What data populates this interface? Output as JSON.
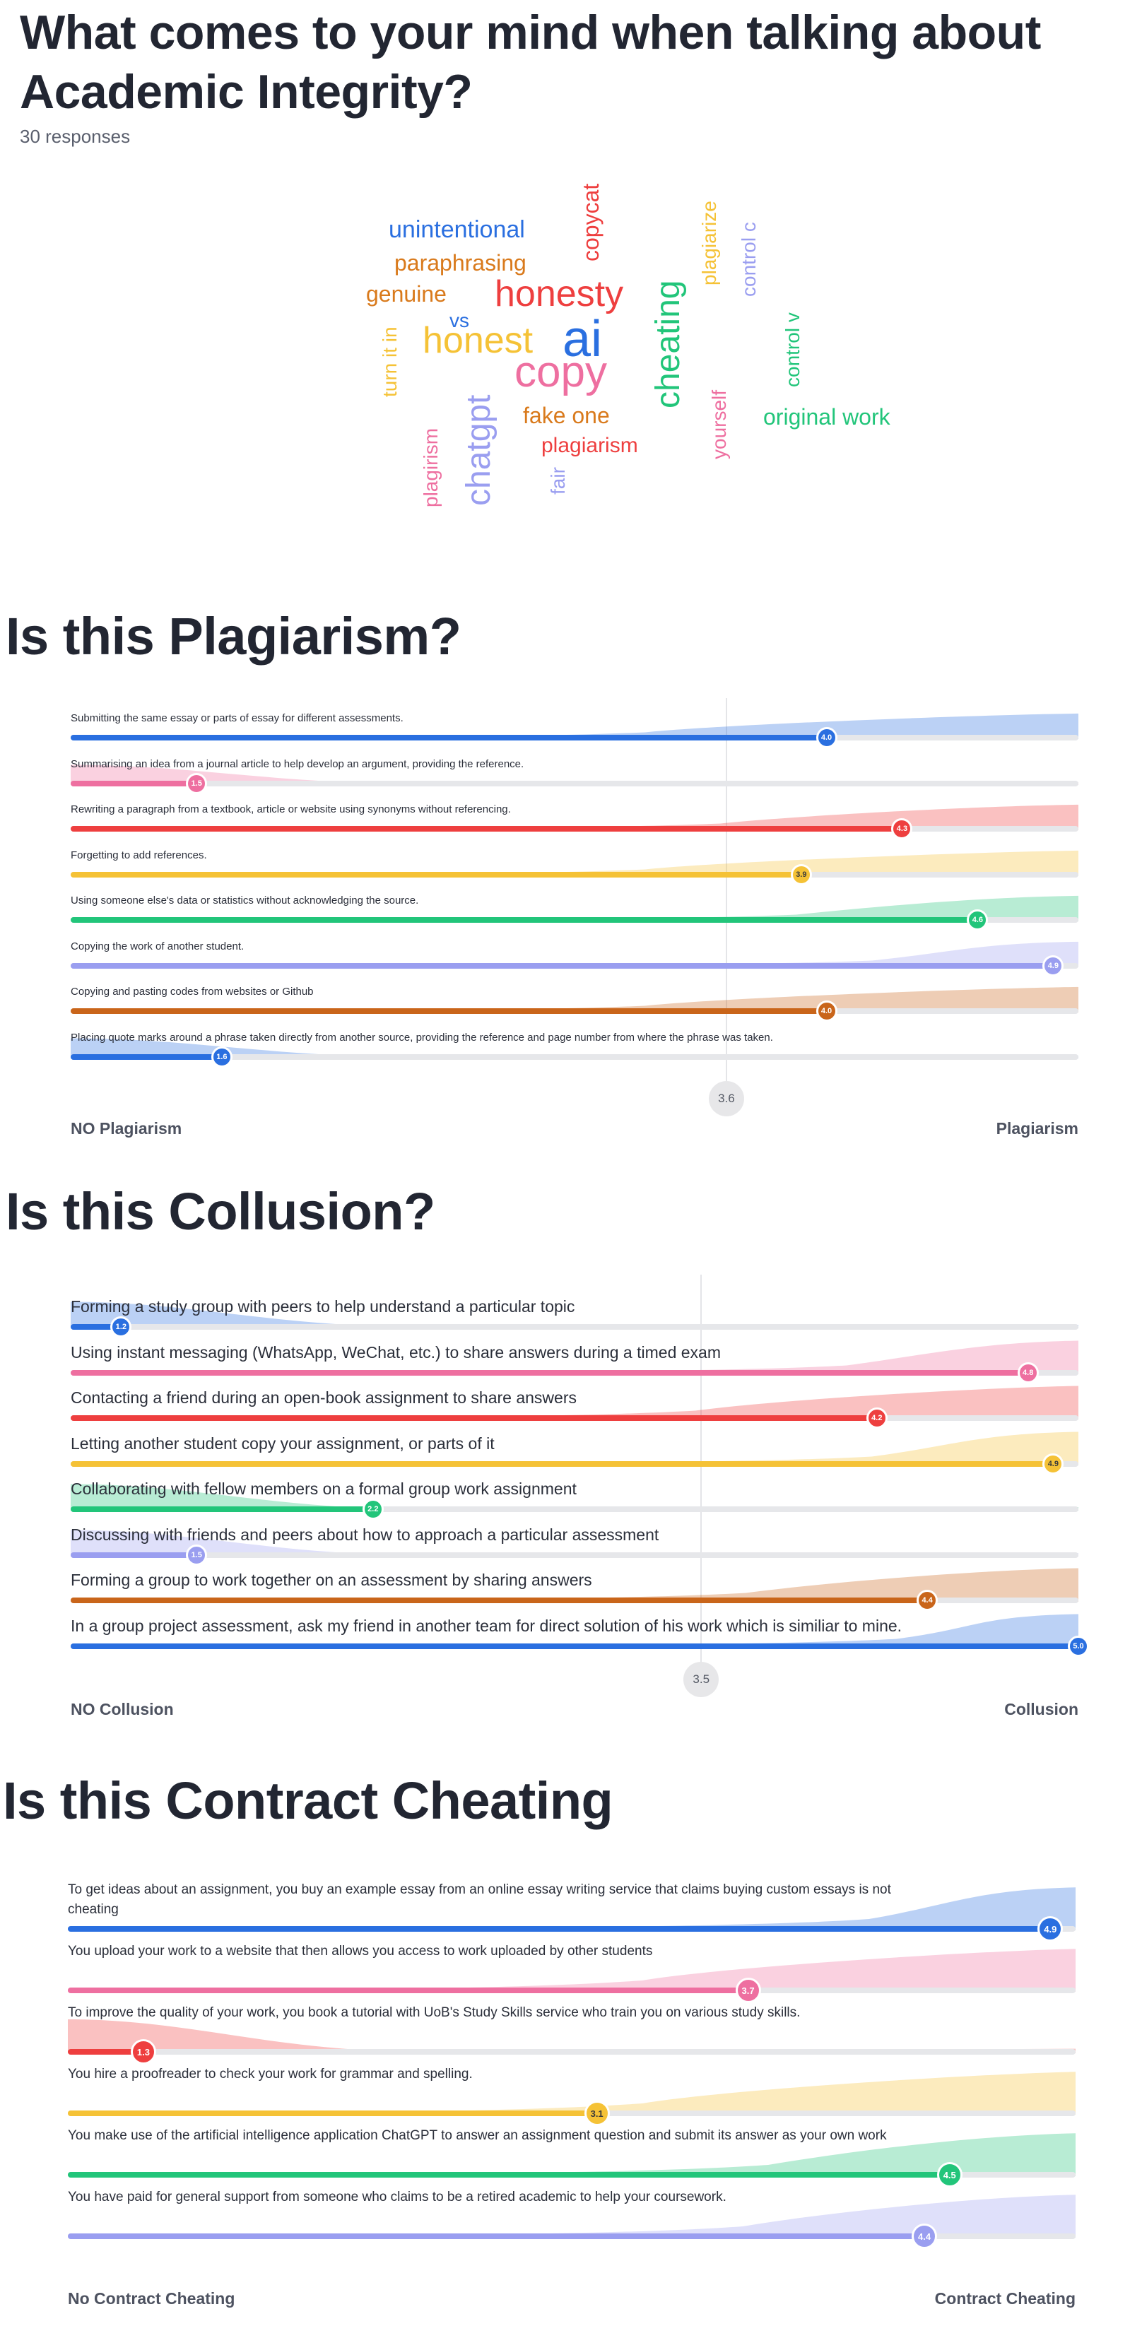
{
  "wordcloud": {
    "title_line1": "What comes to your mind when talking about",
    "title_line2": "Academic Integrity?",
    "responses": "30 responses",
    "words": [
      {
        "text": "unintentional",
        "color": "#2a6fe0",
        "size": 34,
        "vertical": false
      },
      {
        "text": "paraphrasing",
        "color": "#d97a1c",
        "size": 32,
        "vertical": false
      },
      {
        "text": "genuine",
        "color": "#d97a1c",
        "size": 32,
        "vertical": false
      },
      {
        "text": "honesty",
        "color": "#ee3f3f",
        "size": 52,
        "vertical": false
      },
      {
        "text": "vs",
        "color": "#2a6fe0",
        "size": 28,
        "vertical": false
      },
      {
        "text": "honest",
        "color": "#f5c236",
        "size": 52,
        "vertical": false
      },
      {
        "text": "ai",
        "color": "#2a6fe0",
        "size": 72,
        "vertical": false
      },
      {
        "text": "copy",
        "color": "#ee6fa0",
        "size": 62,
        "vertical": false
      },
      {
        "text": "fake one",
        "color": "#d97a1c",
        "size": 32,
        "vertical": false
      },
      {
        "text": "plagiarism",
        "color": "#ee3f3f",
        "size": 30,
        "vertical": false
      },
      {
        "text": "original work",
        "color": "#22c57a",
        "size": 32,
        "vertical": false
      },
      {
        "text": "copycat",
        "color": "#ee3f3f",
        "size": 32,
        "vertical": true
      },
      {
        "text": "plagiarize",
        "color": "#f5c236",
        "size": 28,
        "vertical": true
      },
      {
        "text": "control c",
        "color": "#9a9ef0",
        "size": 28,
        "vertical": true
      },
      {
        "text": "cheating",
        "color": "#22c57a",
        "size": 48,
        "vertical": true
      },
      {
        "text": "control v",
        "color": "#22c57a",
        "size": 28,
        "vertical": true
      },
      {
        "text": "turn it in",
        "color": "#f5c236",
        "size": 28,
        "vertical": true
      },
      {
        "text": "chatgpt",
        "color": "#9a9ef0",
        "size": 48,
        "vertical": true
      },
      {
        "text": "plagirism",
        "color": "#ee6fa0",
        "size": 28,
        "vertical": true
      },
      {
        "text": "yourself",
        "color": "#ee6fa0",
        "size": 28,
        "vertical": true
      },
      {
        "text": "fair",
        "color": "#9a9ef0",
        "size": 28,
        "vertical": true
      }
    ]
  },
  "plagiarism": {
    "title": "Is this Plagiarism?",
    "left_label": "NO Plagiarism",
    "right_label": "Plagiarism",
    "average": "3.6",
    "items": [
      {
        "text": "Submitting the same essay or parts of essay for different assessments.",
        "value": 4.0,
        "label": "4.0",
        "color": "#2a6fe0"
      },
      {
        "text": "Summarising an idea from a journal article to help develop an argument, providing the reference.",
        "value": 1.5,
        "label": "1.5",
        "color": "#ee6fa0"
      },
      {
        "text": "Rewriting a paragraph from a textbook, article or website using synonyms without referencing.",
        "value": 4.3,
        "label": "4.3",
        "color": "#ee3f3f"
      },
      {
        "text": "Forgetting to add references.",
        "value": 3.9,
        "label": "3.9",
        "color": "#f5c236"
      },
      {
        "text": "Using someone else's data or statistics without acknowledging the source.",
        "value": 4.6,
        "label": "4.6",
        "color": "#22c57a"
      },
      {
        "text": "Copying the work of another student.",
        "value": 4.9,
        "label": "4.9",
        "color": "#9a9ef0"
      },
      {
        "text": "Copying and pasting codes from websites or Github",
        "value": 4.0,
        "label": "4.0",
        "color": "#c9651a"
      },
      {
        "text": "Placing quote marks around a phrase taken directly from another source, providing the reference and page number from where the phrase was taken.",
        "value": 1.6,
        "label": "1.6",
        "color": "#2a6fe0"
      }
    ]
  },
  "collusion": {
    "title": "Is this Collusion?",
    "left_label": "NO Collusion",
    "right_label": "Collusion",
    "average": "3.5",
    "items": [
      {
        "text": "Forming a study group with peers to help understand a particular topic",
        "value": 1.2,
        "label": "1.2",
        "color": "#2a6fe0"
      },
      {
        "text": "Using instant messaging (WhatsApp, WeChat, etc.) to share answers during a timed exam",
        "value": 4.8,
        "label": "4.8",
        "color": "#ee6fa0"
      },
      {
        "text": "Contacting a friend during an open-book assignment to share answers",
        "value": 4.2,
        "label": "4.2",
        "color": "#ee3f3f"
      },
      {
        "text": "Letting another student copy your assignment, or parts of it",
        "value": 4.9,
        "label": "4.9",
        "color": "#f5c236"
      },
      {
        "text": "Collaborating with fellow members on a formal group work assignment",
        "value": 2.2,
        "label": "2.2",
        "color": "#22c57a"
      },
      {
        "text": "Discussing with friends and peers about how to approach a particular assessment",
        "value": 1.5,
        "label": "1.5",
        "color": "#9a9ef0"
      },
      {
        "text": "Forming a group to work together on an assessment by sharing answers",
        "value": 4.4,
        "label": "4.4",
        "color": "#c9651a"
      },
      {
        "text": "In a group project assessment, ask my friend in another team for direct solution of his work which is similiar to mine.",
        "value": 5.0,
        "label": "5.0",
        "color": "#2a6fe0"
      }
    ]
  },
  "contract": {
    "title": "Is this Contract Cheating",
    "left_label": "No Contract Cheating",
    "right_label": "Contract Cheating",
    "items": [
      {
        "text": "To get ideas about an assignment, you buy an example essay from an online essay writing service that claims buying custom essays is not",
        "text2": "cheating",
        "value": 4.9,
        "label": "4.9",
        "color": "#2a6fe0"
      },
      {
        "text": "You upload your work to a website that then allows you access to work uploaded by other students",
        "value": 3.7,
        "label": "3.7",
        "color": "#ee6fa0"
      },
      {
        "text": "To improve the quality of your work, you book a tutorial with UoB's Study Skills service who train you on various study skills.",
        "value": 1.3,
        "label": "1.3",
        "color": "#ee3f3f"
      },
      {
        "text": "You hire a proofreader to check your work for grammar and spelling.",
        "value": 3.1,
        "label": "3.1",
        "color": "#f5c236"
      },
      {
        "text": "You make use of the artificial intelligence application ChatGPT to answer an assignment question and submit its answer as your own work",
        "value": 4.5,
        "label": "4.5",
        "color": "#22c57a"
      },
      {
        "text": "You have paid for general support from someone who claims to be a retired academic to help your coursework.",
        "value": 4.4,
        "label": "4.4",
        "color": "#9a9ef0"
      }
    ]
  }
}
